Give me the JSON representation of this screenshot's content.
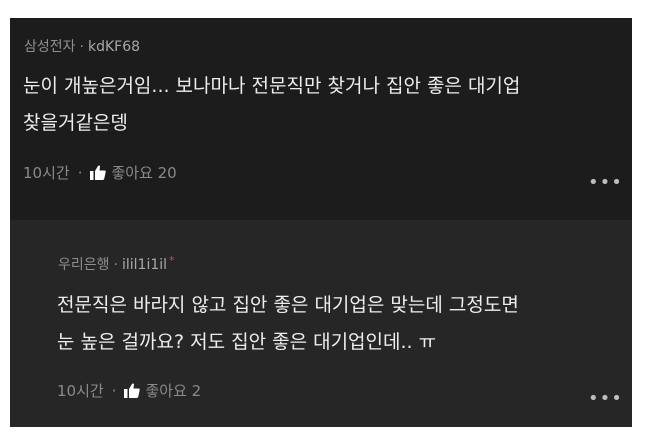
{
  "comments": [
    {
      "company": "삼성전자",
      "author": "kdKF68",
      "text": "눈이 개높은거임... 보나마나 전문직만 찾거나 집안 좋은 대기업\n찾을거같은뎅",
      "time": "10시간",
      "like_label": "좋아요 20"
    },
    {
      "company": "우리은행",
      "author": "ilil1i1il",
      "author_badge": "*",
      "text": "전문직은 바라지 않고 집안 좋은 대기업은 맞는데 그정도면\n눈 높은 걸까요? 저도 집안 좋은 대기업인데.. ㅠ",
      "time": "10시간",
      "like_label": "좋아요 2"
    }
  ],
  "separator": "·",
  "more_label": "•••",
  "icons": {
    "like": "thumbs-up-icon",
    "more": "more-options-icon"
  },
  "colors": {
    "accent_badge": "#e0464a"
  }
}
